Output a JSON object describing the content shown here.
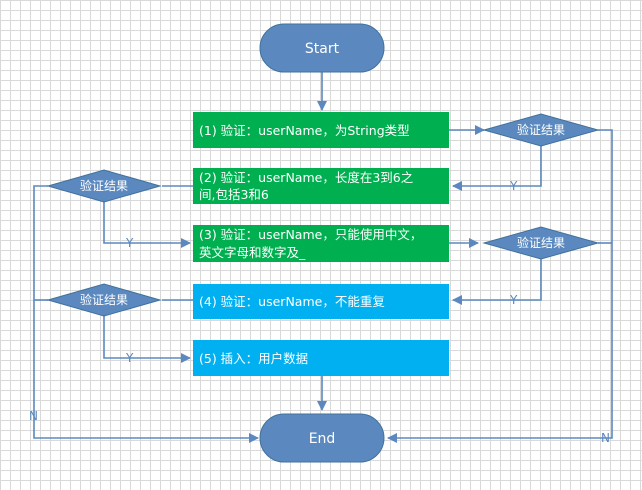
{
  "diagram": {
    "start": "Start",
    "end": "End",
    "decision_label": "验证结果",
    "steps": [
      {
        "text_lines": [
          "(1) 验证：userName，为String类型"
        ]
      },
      {
        "text_lines": [
          "(2) 验证：userName，长度在3到6之",
          "间,包括3和6"
        ]
      },
      {
        "text_lines": [
          "(3) 验证：userName，只能使用中文，",
          "英文字母和数字及_"
        ]
      },
      {
        "text_lines": [
          "(4) 验证：userName，不能重复"
        ]
      },
      {
        "text_lines": [
          "(5) 插入：用户数据"
        ]
      }
    ],
    "edge_labels": {
      "yes": "Y",
      "no": "N"
    },
    "colors": {
      "terminator": "#5b89bf",
      "decision": "#5b89bf",
      "step_green": "#00b050",
      "step_blue": "#00b0f0",
      "connector": "#5b89bf",
      "text_light": "#ffffff"
    }
  }
}
